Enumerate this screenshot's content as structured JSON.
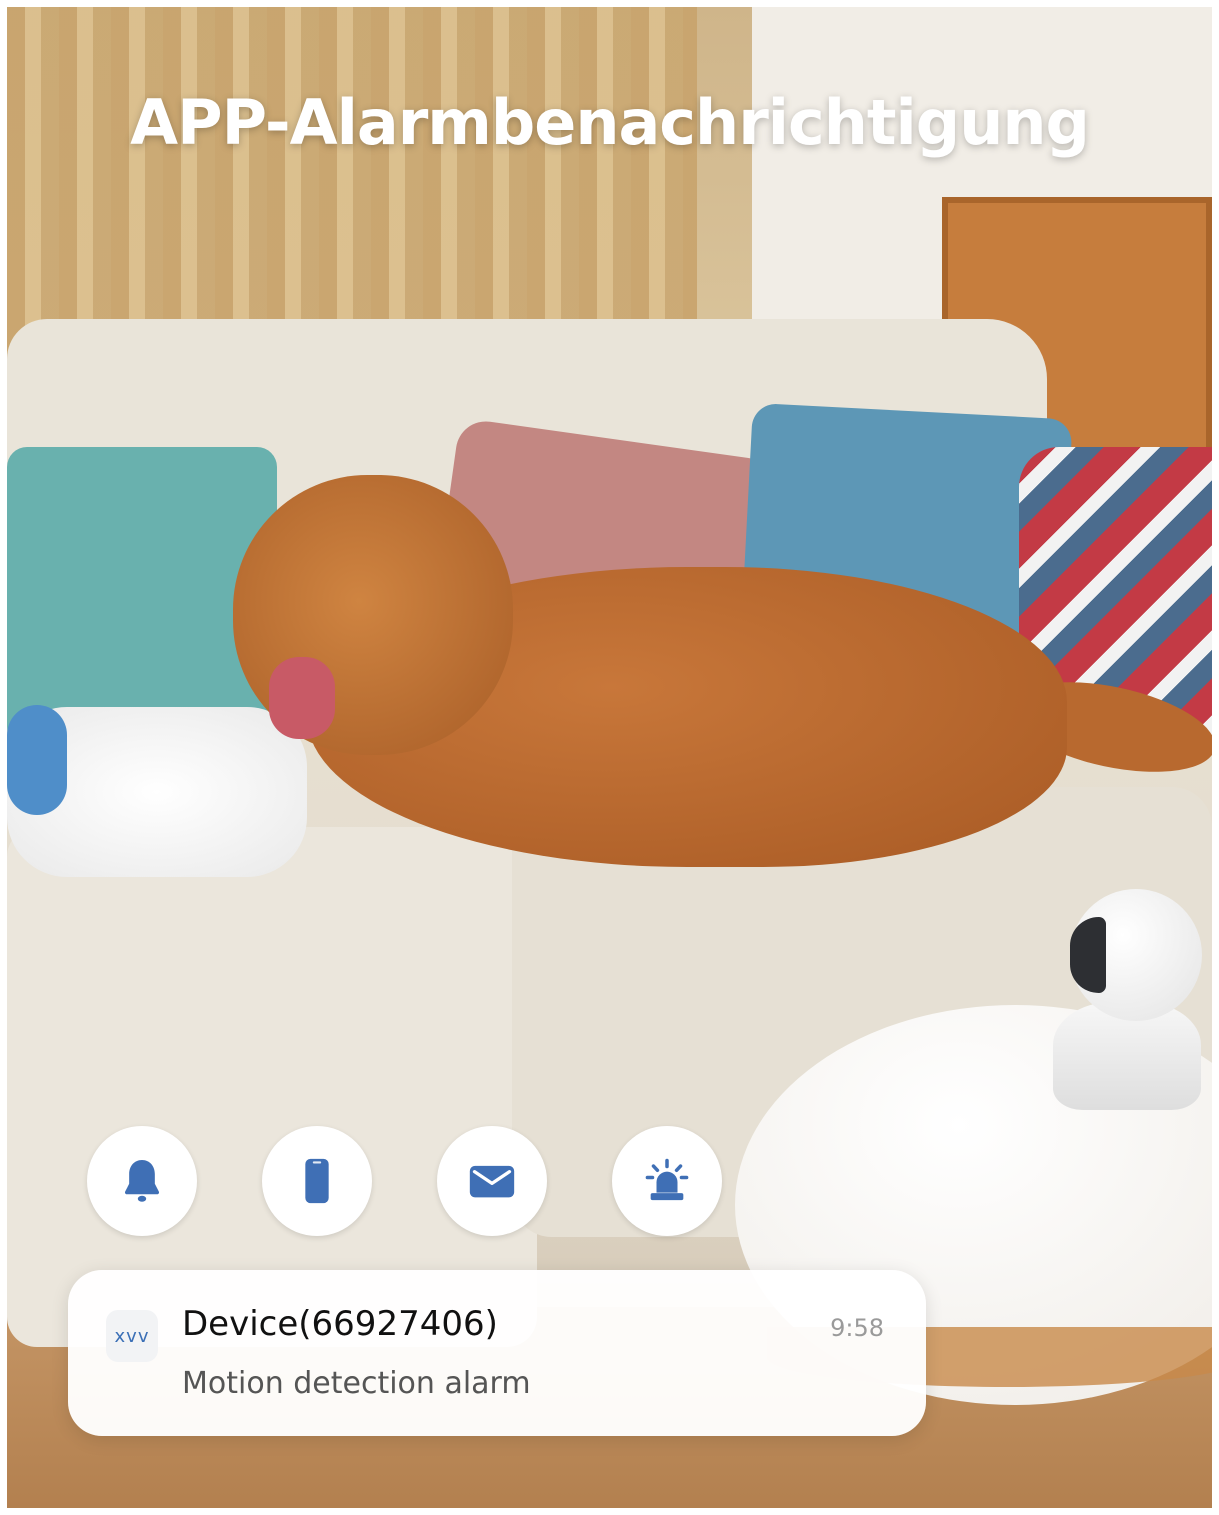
{
  "title": "APP-Alarmbenachrichtigung",
  "channels": [
    {
      "icon": "bell-icon",
      "label": "push-notification"
    },
    {
      "icon": "phone-icon",
      "label": "phone"
    },
    {
      "icon": "mail-icon",
      "label": "email"
    },
    {
      "icon": "siren-icon",
      "label": "siren"
    }
  ],
  "notification": {
    "app_logo": "xvv",
    "title": "Device(66927406)",
    "time": "9:58",
    "body": "Motion detection alarm"
  },
  "colors": {
    "accent": "#3f6fb5",
    "title_text": "#ffffff",
    "notification_bg": "#ffffff"
  }
}
